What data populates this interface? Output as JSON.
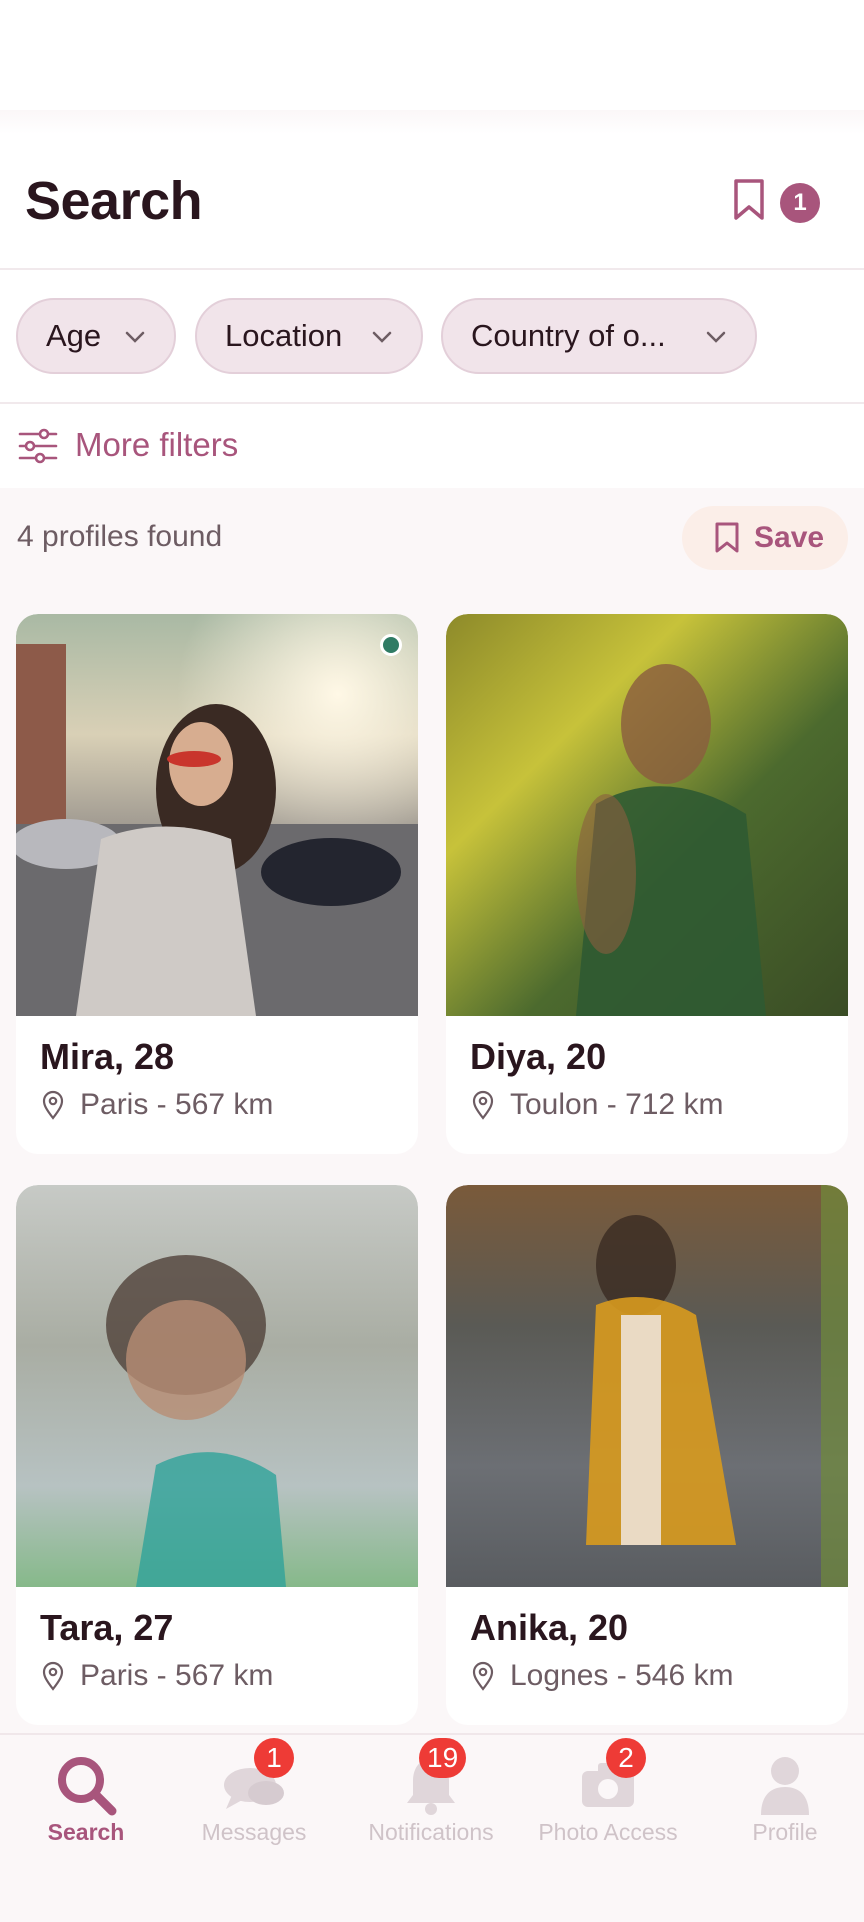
{
  "header": {
    "title": "Search",
    "saved_count": "1"
  },
  "filters": [
    {
      "label": "Age"
    },
    {
      "label": "Location"
    },
    {
      "label": "Country of o..."
    }
  ],
  "more_filters_label": "More filters",
  "results": {
    "count_text": "4 profiles found",
    "save_label": "Save"
  },
  "profiles": [
    {
      "name": "Mira, 28",
      "location": "Paris - 567 km",
      "online": true
    },
    {
      "name": "Diya, 20",
      "location": "Toulon - 712 km",
      "online": false
    },
    {
      "name": "Tara, 27",
      "location": "Paris - 567 km",
      "online": false
    },
    {
      "name": "Anika, 20",
      "location": "Lognes - 546 km",
      "online": false
    }
  ],
  "tabs": [
    {
      "label": "Search",
      "icon": "search-icon",
      "active": true
    },
    {
      "label": "Messages",
      "icon": "chat-icon",
      "badge": "1"
    },
    {
      "label": "Notifications",
      "icon": "bell-icon",
      "badge": "19"
    },
    {
      "label": "Photo Access",
      "icon": "camera-icon",
      "badge": "2"
    },
    {
      "label": "Profile",
      "icon": "person-icon"
    }
  ],
  "colors": {
    "accent": "#a8557c",
    "badge": "#ee3b36",
    "online": "#2f7b64"
  }
}
